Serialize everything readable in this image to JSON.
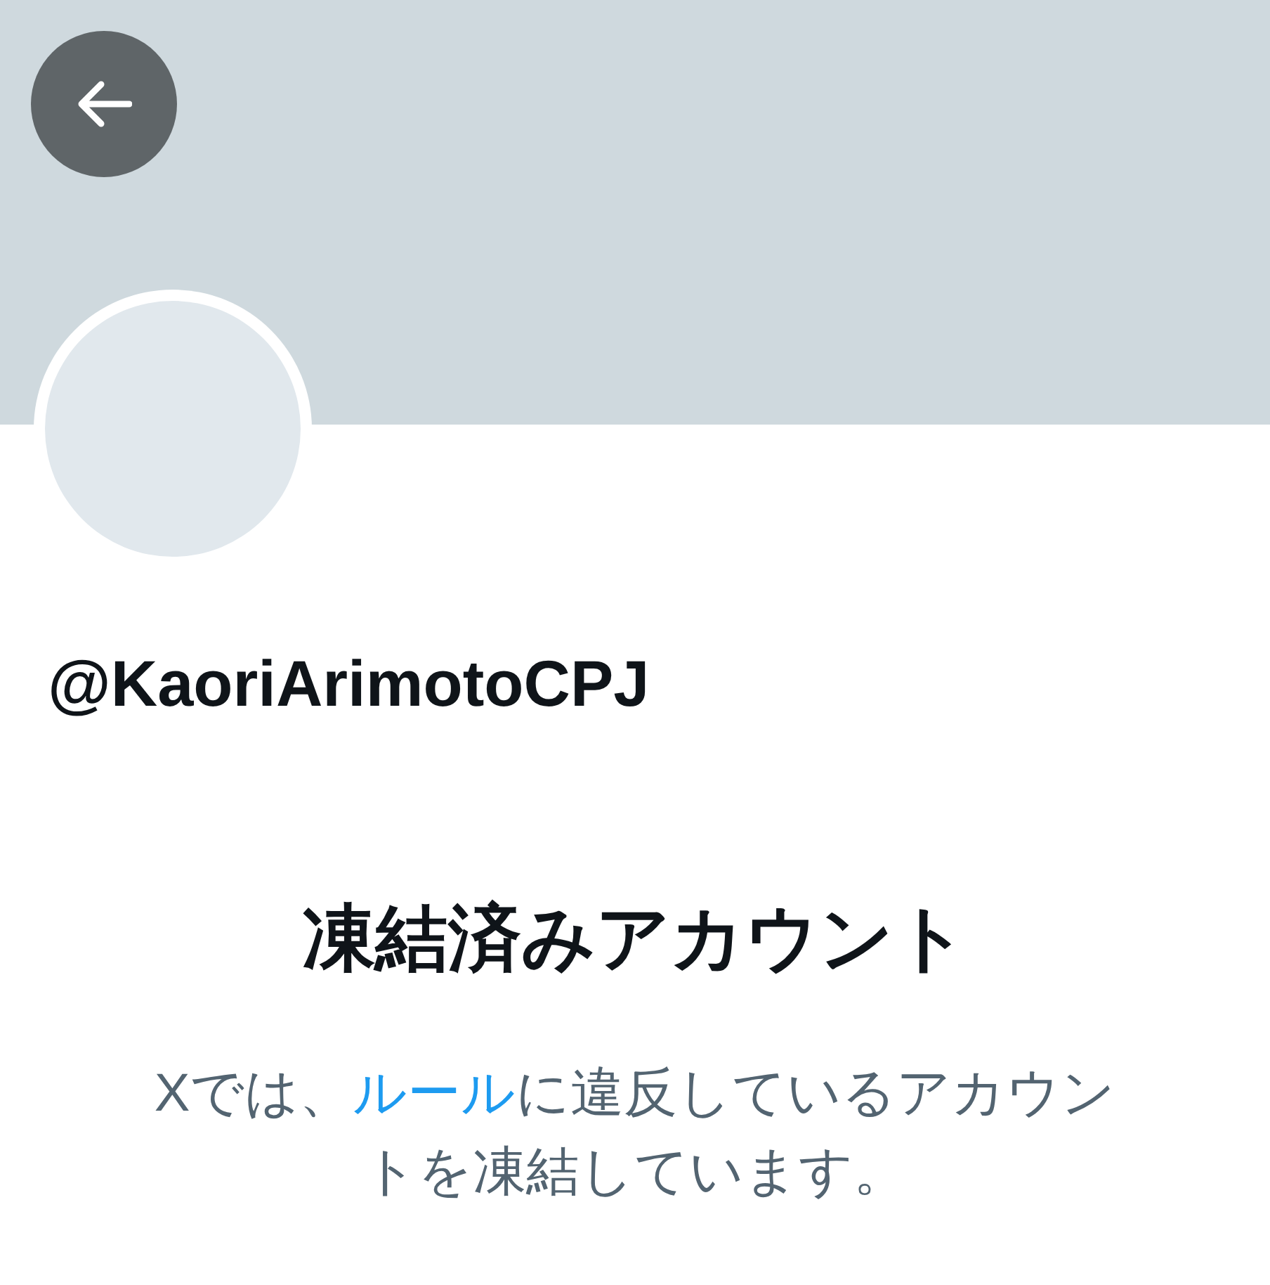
{
  "profile": {
    "avatar": {
      "kind": "placeholder"
    },
    "handle": "@KaoriArimotoCPJ"
  },
  "notice": {
    "title": "凍結済みアカウント",
    "message": {
      "before": "Xでは、",
      "link": "ルール",
      "after": "に違反しているアカウントを凍結しています。"
    }
  }
}
